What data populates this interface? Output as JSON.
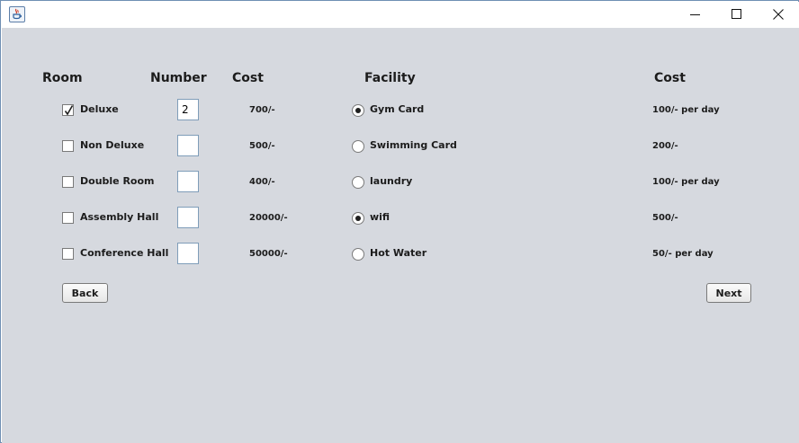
{
  "titlebar": {
    "title": "",
    "icon": "java-coffee-icon",
    "controls": [
      "minimize-icon",
      "maximize-icon",
      "close-icon"
    ]
  },
  "headers": {
    "room": "Room",
    "number": "Number",
    "cost": "Cost",
    "facility": "Facility",
    "facility_cost": "Cost"
  },
  "rooms": [
    {
      "label": "Deluxe",
      "checked": true,
      "number": "2",
      "cost": "700/-"
    },
    {
      "label": "Non Deluxe",
      "checked": false,
      "number": "",
      "cost": "500/-"
    },
    {
      "label": "Double Room",
      "checked": false,
      "number": "",
      "cost": "400/-"
    },
    {
      "label": "Assembly Hall",
      "checked": false,
      "number": "",
      "cost": "20000/-"
    },
    {
      "label": "Conference Hall",
      "checked": false,
      "number": "",
      "cost": "50000/-"
    }
  ],
  "facilities": [
    {
      "label": "Gym Card",
      "selected": true,
      "cost": "100/- per day"
    },
    {
      "label": "Swimming Card",
      "selected": false,
      "cost": "200/-"
    },
    {
      "label": "laundry",
      "selected": false,
      "cost": "100/- per day"
    },
    {
      "label": "wifi",
      "selected": true,
      "cost": "500/-"
    },
    {
      "label": "Hot Water",
      "selected": false,
      "cost": "50/- per day"
    }
  ],
  "buttons": {
    "back": "Back",
    "next": "Next"
  },
  "colors": {
    "panel_background": "#d6d9df",
    "window_border": "#6f8fb3"
  }
}
